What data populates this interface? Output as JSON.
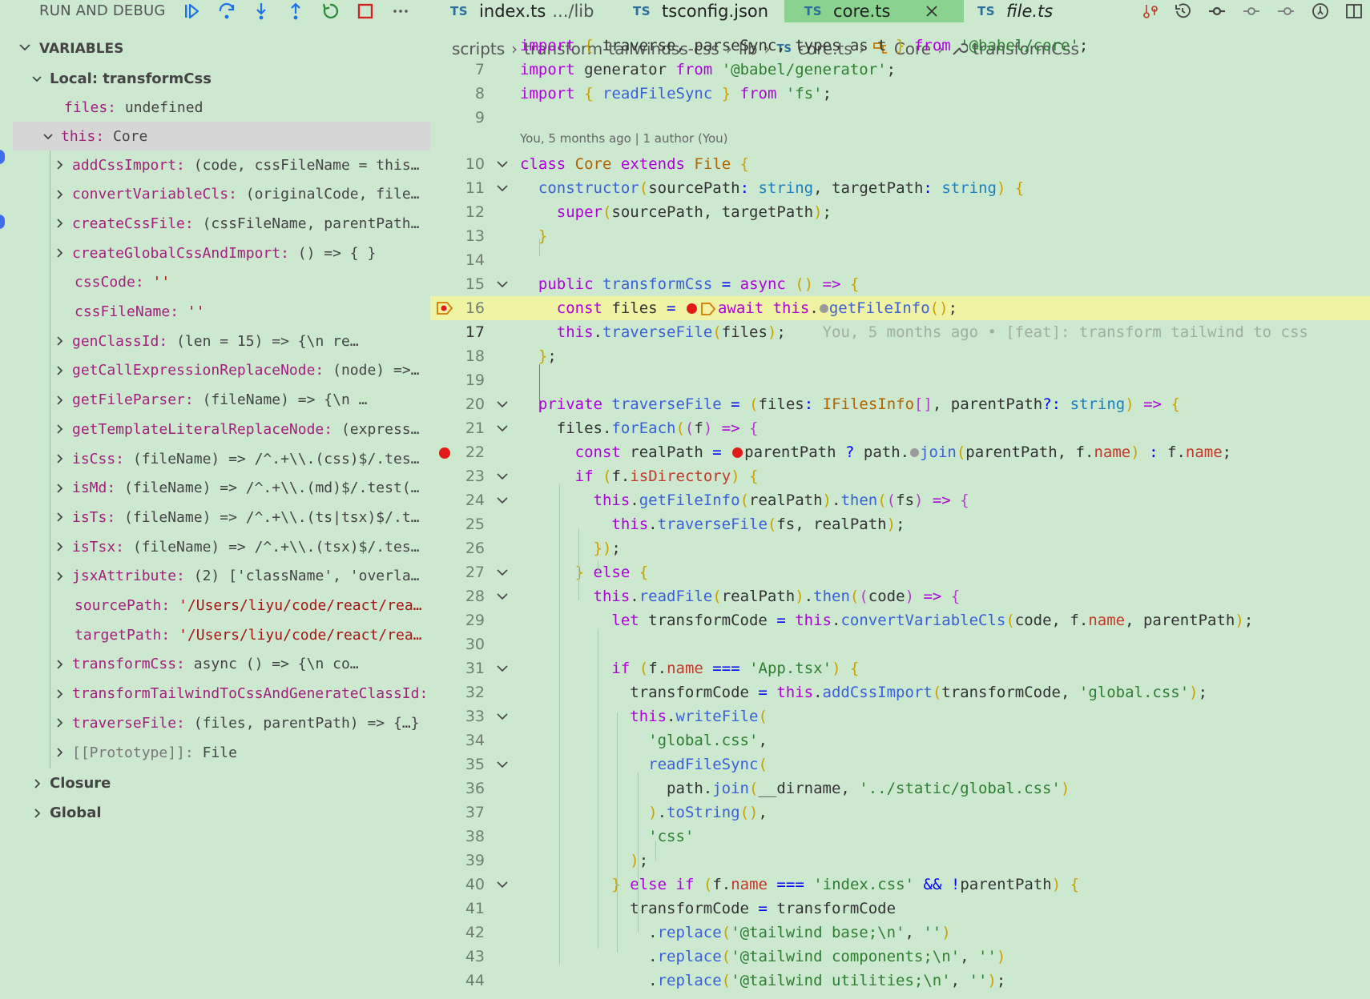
{
  "debug": {
    "title": "RUN AND DEBUG"
  },
  "variables": {
    "header": "VARIABLES",
    "scope_local": "Local: transformCss",
    "files_key": "files:",
    "files_val": "undefined",
    "this_key": "this:",
    "this_val": "Core",
    "members": [
      {
        "key": "addCssImport:",
        "value": "(code, cssFileName = this…",
        "expandable": true,
        "kind": "fn"
      },
      {
        "key": "convertVariableCls:",
        "value": "(originalCode, file…",
        "expandable": true,
        "kind": "fn"
      },
      {
        "key": "createCssFile:",
        "value": "(cssFileName, parentPath…",
        "expandable": true,
        "kind": "fn"
      },
      {
        "key": "createGlobalCssAndImport:",
        "value": "() => { }",
        "expandable": true,
        "kind": "fn"
      },
      {
        "key": "cssCode:",
        "value": "''",
        "expandable": false,
        "kind": "str"
      },
      {
        "key": "cssFileName:",
        "value": "''",
        "expandable": false,
        "kind": "str"
      },
      {
        "key": "genClassId:",
        "value": "(len = 15) => {\\n         re…",
        "expandable": true,
        "kind": "fn"
      },
      {
        "key": "getCallExpressionReplaceNode:",
        "value": "(node) =>…",
        "expandable": true,
        "kind": "fn"
      },
      {
        "key": "getFileParser:",
        "value": "(fileName) => {\\n          …",
        "expandable": true,
        "kind": "fn"
      },
      {
        "key": "getTemplateLiteralReplaceNode:",
        "value": "(express…",
        "expandable": true,
        "kind": "fn"
      },
      {
        "key": "isCss:",
        "value": "(fileName) => /^.+\\\\.(css)$/.tes…",
        "expandable": true,
        "kind": "fn"
      },
      {
        "key": "isMd:",
        "value": "(fileName) => /^.+\\\\.(md)$/.test(…",
        "expandable": true,
        "kind": "fn"
      },
      {
        "key": "isTs:",
        "value": "(fileName) => /^.+\\\\.(ts|tsx)$/.t…",
        "expandable": true,
        "kind": "fn"
      },
      {
        "key": "isTsx:",
        "value": "(fileName) => /^.+\\\\.(tsx)$/.tes…",
        "expandable": true,
        "kind": "fn"
      },
      {
        "key": "jsxAttribute:",
        "value": "(2) ['className', 'overla…",
        "expandable": true,
        "kind": "fn"
      },
      {
        "key": "sourcePath:",
        "value": "'/Users/liyu/code/react/rea…",
        "expandable": false,
        "kind": "str"
      },
      {
        "key": "targetPath:",
        "value": "'/Users/liyu/code/react/rea…",
        "expandable": false,
        "kind": "str"
      },
      {
        "key": "transformCss:",
        "value": "async () => {\\n         co…",
        "expandable": true,
        "kind": "fn"
      },
      {
        "key": "transformTailwindToCssAndGenerateClassId:",
        "value": "",
        "expandable": true,
        "kind": "fn"
      },
      {
        "key": "traverseFile:",
        "value": "(files, parentPath) => {…}",
        "expandable": true,
        "kind": "fn"
      },
      {
        "key": "[[Prototype]]:",
        "value": "File",
        "expandable": true,
        "kind": "proto"
      }
    ],
    "closure": "Closure",
    "global": "Global"
  },
  "tabs": [
    {
      "badge": "TS",
      "label": "index.ts",
      "hint": ".../lib",
      "italic": false,
      "active": false
    },
    {
      "badge": "TS",
      "label": "tsconfig.json",
      "hint": "",
      "italic": false,
      "active": false
    },
    {
      "badge": "TS",
      "label": "core.ts",
      "hint": "",
      "italic": false,
      "active": true
    },
    {
      "badge": "TS",
      "label": "file.ts",
      "hint": "",
      "italic": true,
      "active": false
    }
  ],
  "breadcrumb": {
    "p1": "scripts",
    "p2": "transform-tailwindss-css",
    "p3": "lib",
    "badge": "TS",
    "p4": "core.ts",
    "p5": "Core",
    "p6": "transformCss"
  },
  "editor": {
    "codelens": "You, 5 months ago | 1 author (You)",
    "blame": "You, 5 months ago • [feat]: transform tailwind to css",
    "line_numbers": [
      "7",
      "8",
      "9",
      "10",
      "11",
      "12",
      "13",
      "14",
      "15",
      "16",
      "17",
      "18",
      "19",
      "20",
      "21",
      "22",
      "23",
      "24",
      "25",
      "26",
      "27",
      "28",
      "29",
      "30",
      "31",
      "32",
      "33",
      "34",
      "35",
      "36",
      "37",
      "38",
      "39",
      "40",
      "41",
      "42",
      "43",
      "44"
    ],
    "code": [
      "import generator from '@babel/generator';",
      "import { readFileSync } from 'fs';",
      "",
      "class Core extends File {",
      "  constructor(sourcePath: string, targetPath: string) {",
      "    super(sourcePath, targetPath);",
      "  }",
      "",
      "  public transformCss = async () => {",
      "    const files = await this.getFileInfo();",
      "    this.traverseFile(files);",
      "  };",
      "",
      "  private traverseFile = (files: IFilesInfo[], parentPath?: string) => {",
      "    files.forEach((f) => {",
      "      const realPath = parentPath ? path.join(parentPath, f.name) : f.name;",
      "      if (f.isDirectory) {",
      "        this.getFileInfo(realPath).then((fs) => {",
      "          this.traverseFile(fs, realPath);",
      "        });",
      "      } else {",
      "        this.readFile(realPath).then((code) => {",
      "          let transformCode = this.convertVariableCls(code, f.name, parentPath);",
      "",
      "          if (f.name === 'App.tsx') {",
      "            transformCode = this.addCssImport(transformCode, 'global.css');",
      "            this.writeFile(",
      "              'global.css',",
      "              readFileSync(",
      "                path.join(__dirname, '../static/global.css')",
      "              ).toString(),",
      "              'css'",
      "            );",
      "          } else if (f.name === 'index.css' && !parentPath) {",
      "            transformCode = transformCode",
      "              .replace('@tailwind base;\\n', '')",
      "              .replace('@tailwind components;\\n', '')",
      "              .replace('@tailwind utilities;\\n', '');"
    ],
    "partial_top_line": "import { traverse, parseSync, types as t } from '@babel/core';"
  },
  "colors": {
    "background": "#cce8cf",
    "active_tab": "#8ad28f",
    "current_line": "#f0f2a4",
    "breakpoint": "#e21a1a",
    "selected_row": "#d6d6d6"
  }
}
